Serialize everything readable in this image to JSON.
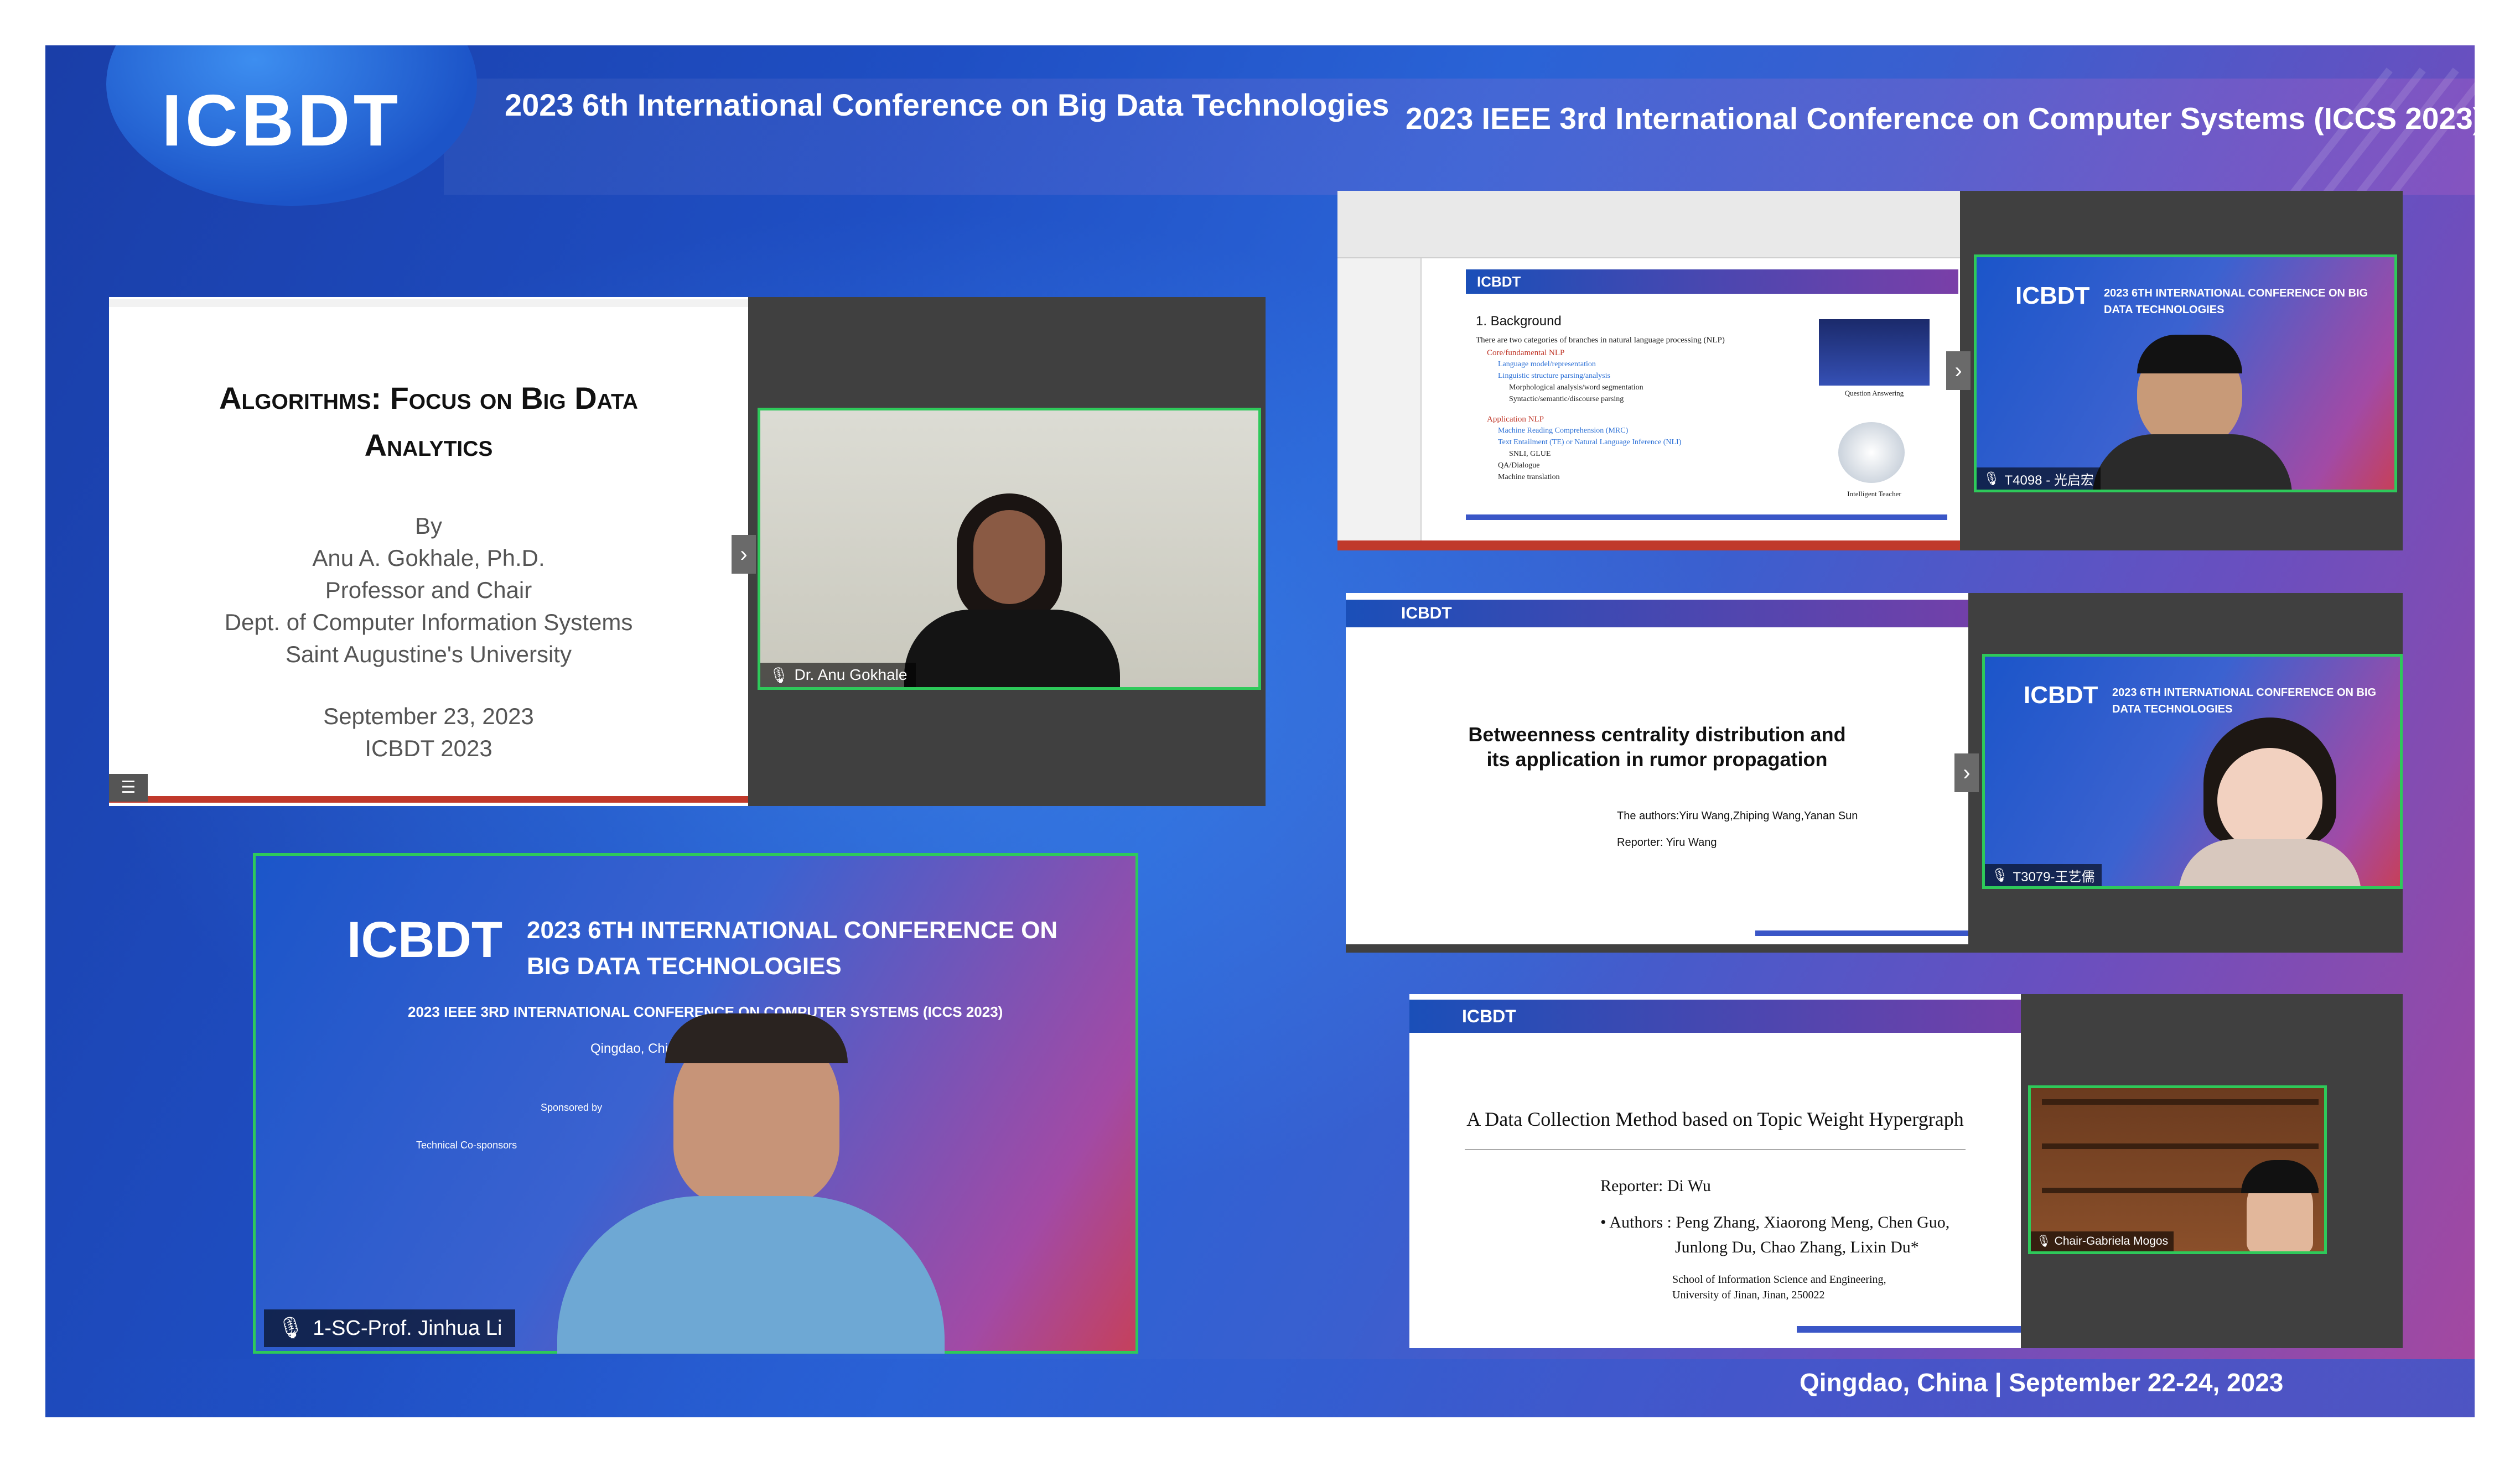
{
  "header": {
    "logo": "ICBDT",
    "left_title": "2023 6th International Conference on Big Data Technologies",
    "right_title": "2023 IEEE 3rd International Conference on Computer Systems (ICCS 2023)",
    "footer": "Qingdao, China | September 22-24, 2023"
  },
  "tile1": {
    "slide_title_1": "Algorithms: Focus on Big Data",
    "slide_title_2": "Analytics",
    "by": "By",
    "author": "Anu A. Gokhale, Ph.D.",
    "role": "Professor and Chair",
    "dept": "Dept. of Computer Information Systems",
    "univ": "Saint Augustine's University",
    "date": "September 23, 2023",
    "event": "ICBDT 2023",
    "speaker": "Dr. Anu Gokhale"
  },
  "tile2": {
    "slide_banner": "ICBDT",
    "section": "1. Background",
    "intro": "There are two categories of branches in natural language processing (NLP)",
    "item1": "Core/fundamental NLP",
    "item1a": "Language model/representation",
    "item1b": "Linguistic structure parsing/analysis",
    "item1b1": "Morphological analysis/word segmentation",
    "item1b2": "Syntactic/semantic/discourse parsing",
    "item2": "Application NLP",
    "item2a": "Machine Reading Comprehension (MRC)",
    "item2b": "Text Entailment (TE) or Natural Language Inference (NLI)",
    "item2b1": "SNLI, GLUE",
    "item2c": "QA/Dialogue",
    "item2d": "Machine translation",
    "cap1": "Question Answering",
    "cap2": "Intelligent Teacher",
    "cam_title": "2023 6TH INTERNATIONAL CONFERENCE ON BIG DATA TECHNOLOGIES",
    "speaker": "T4098 - 光启宏"
  },
  "tile3": {
    "title_1": "Betweenness centrality distribution and",
    "title_2": "its application in rumor propagation",
    "authors": "The authors:Yiru Wang,Zhiping Wang,Yanan Sun",
    "reporter": "Reporter:  Yiru Wang",
    "speaker": "T3079-王艺儒"
  },
  "tile4": {
    "title": "A Data Collection Method based on Topic Weight Hypergraph",
    "reporter": "Reporter: Di Wu",
    "authors_1": "• Authors : Peng Zhang, Xiaorong Meng, Chen Guo,",
    "authors_2": "Junlong Du, Chao Zhang, Lixin Du*",
    "school_1": "School of Information Science and Engineering,",
    "school_2": "University of Jinan, Jinan, 250022",
    "speaker": "Chair-Gabriela Mogos"
  },
  "tile5": {
    "logo": "ICBDT",
    "title_1": "2023 6TH INTERNATIONAL CONFERENCE ON",
    "title_2": "BIG DATA TECHNOLOGIES",
    "sub": "2023 IEEE 3RD INTERNATIONAL CONFERENCE ON COMPUTER SYSTEMS (ICCS 2023)",
    "city": "Qingdao, China",
    "sponsored": "Sponsored by",
    "tech": "Technical Co-sponsors",
    "speaker": "1-SC-Prof. Jinhua Li"
  },
  "colors": {
    "active_speaker_border": "#2ec95a",
    "tile_background": "#404040"
  }
}
